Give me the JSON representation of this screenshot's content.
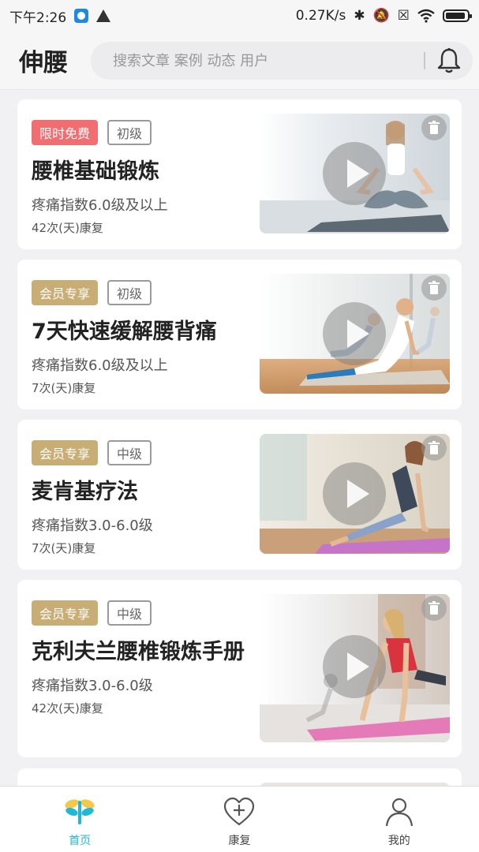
{
  "status_bar": {
    "time": "下午2:26",
    "speed": "0.27K/s",
    "icons": [
      "app-icon",
      "warning-icon",
      "bluetooth-icon",
      "mute-icon",
      "no-sim-icon",
      "wifi-icon",
      "battery-icon"
    ]
  },
  "header": {
    "title": "伸腰",
    "search_placeholder": "搜索文章 案例 动态 用户",
    "bell_icon": "bell-icon"
  },
  "cards": [
    {
      "badge": "限时免费",
      "level": "初级",
      "title": "腰椎基础锻炼",
      "pain": "疼痛指数6.0级及以上",
      "days": "42次(天)康复"
    },
    {
      "badge": "会员专享",
      "level": "初级",
      "title": "7天快速缓解腰背痛",
      "pain": "疼痛指数6.0级及以上",
      "days": "7次(天)康复"
    },
    {
      "badge": "会员专享",
      "level": "中级",
      "title": "麦肯基疗法",
      "pain": "疼痛指数3.0-6.0级",
      "days": "7次(天)康复"
    },
    {
      "badge": "会员专享",
      "level": "中级",
      "title": "克利夫兰腰椎锻炼手册",
      "pain": "疼痛指数3.0-6.0级",
      "days": "42次(天)康复"
    }
  ],
  "bottom_nav": [
    {
      "label": "首页",
      "icon": "dragonfly-icon",
      "active": true
    },
    {
      "label": "康复",
      "icon": "heart-plus-icon",
      "active": false
    },
    {
      "label": "我的",
      "icon": "user-icon",
      "active": false
    }
  ],
  "colors": {
    "free_badge": "#f06e72",
    "vip_badge": "#c8ad74",
    "active_nav": "#1fb8d6"
  }
}
